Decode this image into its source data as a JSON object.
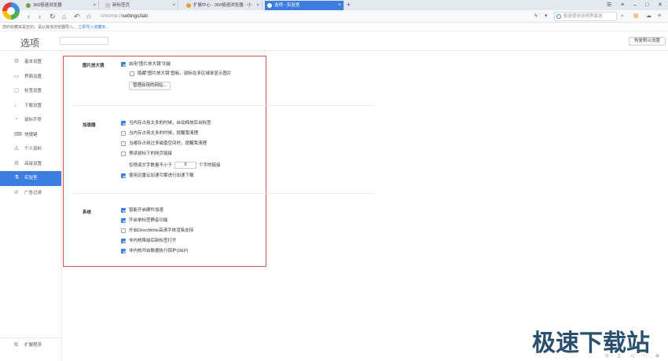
{
  "browser": {
    "tabs": [
      {
        "label": "360极速浏览器",
        "active": false
      },
      {
        "label": "新标签页",
        "active": false
      },
      {
        "label": "扩展中心 - 360极速浏览器 - 小",
        "active": false
      },
      {
        "label": "选项 - 实验室",
        "active": true
      }
    ],
    "address": {
      "host": "chrome://",
      "path": "settings/lab"
    },
    "search_placeholder": "极速使用说明界面说",
    "favorites_hint": "您的收藏夹是空的，请从其他浏览器导入。",
    "favorites_import": "立即导入收藏夹..."
  },
  "settings": {
    "title": "选项",
    "restore_button": "恢复默认设置",
    "sidebar": [
      {
        "label": "基本设置",
        "icon": "gear-icon",
        "active": false
      },
      {
        "label": "界面设置",
        "icon": "window-icon",
        "active": false
      },
      {
        "label": "标签设置",
        "icon": "tab-icon",
        "active": false
      },
      {
        "label": "下载设置",
        "icon": "download-icon",
        "active": false
      },
      {
        "label": "鼠标手势",
        "icon": "mouse-icon",
        "active": false
      },
      {
        "label": "快捷键",
        "icon": "keyboard-icon",
        "active": false
      },
      {
        "label": "个人资料",
        "icon": "person-icon",
        "active": false
      },
      {
        "label": "高级设置",
        "icon": "settings-icon",
        "active": false
      },
      {
        "label": "实验室",
        "icon": "flask-icon",
        "active": true
      },
      {
        "label": "广告过滤",
        "icon": "block-icon",
        "active": false
      }
    ],
    "ext_program": "扩展程序",
    "sections": {
      "magnifier": {
        "label": "图片放大镜",
        "enable": "启用\"图片放大镜\"功能",
        "hide_icon": "隐藏\"图片放大镜\"图标，鼠标在多区域单显示图片",
        "manage_button": "管理启用的网站..."
      },
      "accelerator": {
        "label": "加速器",
        "opt1": "当内存占用太多的时候，自动释放后台标签",
        "opt2": "当内存占用太多的时候，提醒我清理",
        "opt3": "当缓存占用过多磁盘空间时，提醒我清理",
        "opt4": "预读鼠标下的网页链接",
        "prefetch_prefix": "仅预读文字数量不小于",
        "prefetch_value": "9",
        "prefetch_suffix": "个字的链接",
        "opt5": "使用迅雷云加速引擎进行加速下载"
      },
      "system": {
        "label": "系统",
        "opt1": "智能开启硬件加速",
        "opt2": "开启单标签静音功能",
        "opt3": "开启DirectWrite高清字体渲染支持",
        "opt4": "非内核降级后新标签打开",
        "opt5": "非内核开启数据执行保护(DEP)"
      }
    }
  },
  "watermark": "极速下载站"
}
